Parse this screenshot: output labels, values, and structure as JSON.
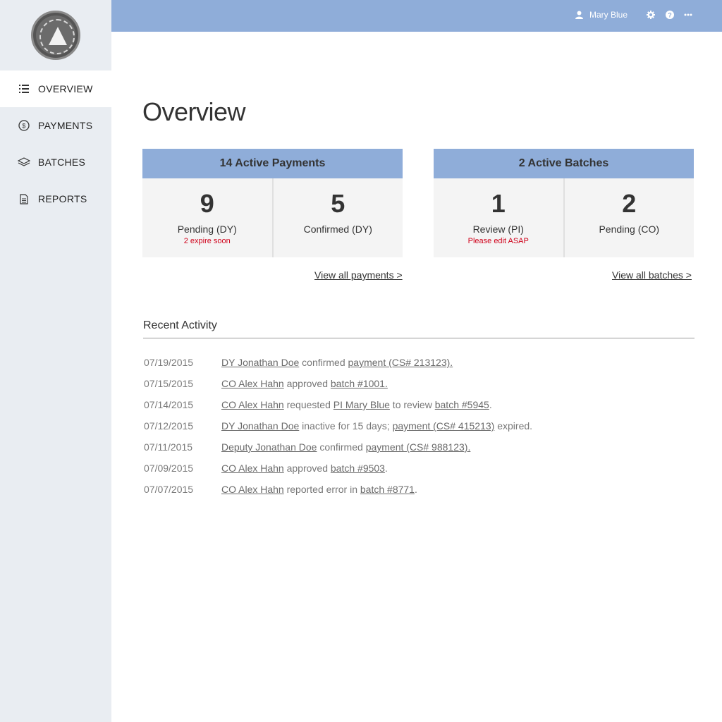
{
  "sidebar": {
    "logo": "agency-seal",
    "items": [
      {
        "label": "OVERVIEW",
        "icon": "list-icon",
        "active": true
      },
      {
        "label": "PAYMENTS",
        "icon": "dollar-circle-icon",
        "active": false
      },
      {
        "label": "BATCHES",
        "icon": "layers-icon",
        "active": false
      },
      {
        "label": "REPORTS",
        "icon": "document-icon",
        "active": false
      }
    ]
  },
  "topbar": {
    "user_name": "Mary Blue",
    "icons": [
      "user-icon",
      "gear-icon",
      "help-icon",
      "more-icon"
    ]
  },
  "page": {
    "title": "Overview"
  },
  "payments_card": {
    "header": "14 Active Payments",
    "stats": [
      {
        "value": "9",
        "label": "Pending (DY)",
        "note": "2 expire soon"
      },
      {
        "value": "5",
        "label": "Confirmed (DY)",
        "note": ""
      }
    ],
    "link": "View all payments >"
  },
  "batches_card": {
    "header": "2 Active Batches",
    "stats": [
      {
        "value": "1",
        "label": "Review (PI)",
        "note": "Please edit ASAP"
      },
      {
        "value": "2",
        "label": "Pending (CO)",
        "note": ""
      }
    ],
    "link": "View all batches >"
  },
  "recent_activity": {
    "title": "Recent Activity",
    "rows": [
      {
        "date": "07/19/2015",
        "parts": [
          {
            "t": "DY Jonathan Doe",
            "link": true
          },
          {
            "t": " confirmed ",
            "link": false
          },
          {
            "t": "payment (CS# 213123).",
            "link": true
          }
        ]
      },
      {
        "date": "07/15/2015",
        "parts": [
          {
            "t": "CO Alex Hahn",
            "link": true
          },
          {
            "t": " approved ",
            "link": false
          },
          {
            "t": "batch #1001.",
            "link": true
          }
        ]
      },
      {
        "date": "07/14/2015",
        "parts": [
          {
            "t": "CO Alex Hahn",
            "link": true
          },
          {
            "t": " requested ",
            "link": false
          },
          {
            "t": "PI Mary Blue",
            "link": true
          },
          {
            "t": " to review ",
            "link": false
          },
          {
            "t": "batch #5945",
            "link": true
          },
          {
            "t": ".",
            "link": false
          }
        ]
      },
      {
        "date": "07/12/2015",
        "parts": [
          {
            "t": "DY Jonathan Doe",
            "link": true
          },
          {
            "t": " inactive for 15 days; ",
            "link": false
          },
          {
            "t": "payment (CS# 415213)",
            "link": true
          },
          {
            "t": " expired.",
            "link": false
          }
        ]
      },
      {
        "date": "07/11/2015",
        "parts": [
          {
            "t": "Deputy Jonathan Doe",
            "link": true
          },
          {
            "t": " confirmed ",
            "link": false
          },
          {
            "t": "payment (CS# 988123).",
            "link": true
          }
        ]
      },
      {
        "date": "07/09/2015",
        "parts": [
          {
            "t": "CO Alex Hahn",
            "link": true
          },
          {
            "t": " approved ",
            "link": false
          },
          {
            "t": "batch #9503",
            "link": true
          },
          {
            "t": ".",
            "link": false
          }
        ]
      },
      {
        "date": "07/07/2015",
        "parts": [
          {
            "t": "CO Alex Hahn",
            "link": true
          },
          {
            "t": " reported error in ",
            "link": false
          },
          {
            "t": "batch #8771",
            "link": true
          },
          {
            "t": ".",
            "link": false
          }
        ]
      }
    ]
  },
  "colors": {
    "accent": "#8fadd9",
    "sidebar_bg": "#e9edf2",
    "warning": "#d0021b"
  }
}
